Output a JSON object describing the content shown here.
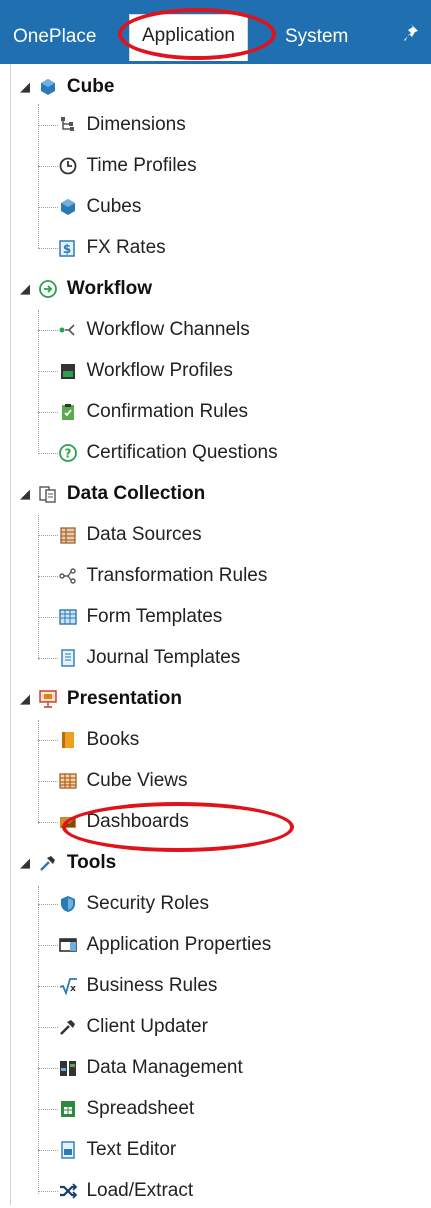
{
  "tabs": {
    "oneplace": "OnePlace",
    "application": "Application",
    "system": "System",
    "active": "Application"
  },
  "tree": {
    "cube": {
      "label": "Cube",
      "items": [
        "Dimensions",
        "Time Profiles",
        "Cubes",
        "FX Rates"
      ]
    },
    "workflow": {
      "label": "Workflow",
      "items": [
        "Workflow Channels",
        "Workflow Profiles",
        "Confirmation Rules",
        "Certification Questions"
      ]
    },
    "data_collection": {
      "label": "Data Collection",
      "items": [
        "Data Sources",
        "Transformation Rules",
        "Form Templates",
        "Journal Templates"
      ]
    },
    "presentation": {
      "label": "Presentation",
      "items": [
        "Books",
        "Cube Views",
        "Dashboards"
      ]
    },
    "tools": {
      "label": "Tools",
      "items": [
        "Security Roles",
        "Application Properties",
        "Business Rules",
        "Client Updater",
        "Data Management",
        "Spreadsheet",
        "Text Editor",
        "Load/Extract"
      ]
    }
  },
  "highlight_color": "#e0121c",
  "accent_color": "#1f6fb1"
}
